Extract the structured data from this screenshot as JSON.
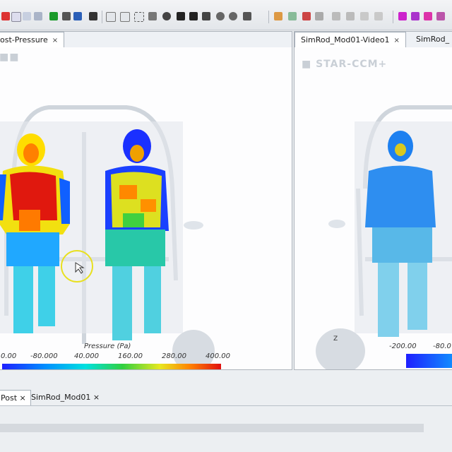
{
  "left_panel": {
    "tab_label": "ost-Pressure",
    "tab_close": "×",
    "legend": {
      "title": "Pressure (Pa)",
      "ticks": [
        "0.00",
        "-80.000",
        "40.000",
        "160.00",
        "280.00",
        "400.00"
      ]
    }
  },
  "right_panel": {
    "tabs": [
      {
        "label": "SimRod_Mod01-Video1",
        "close": "×"
      },
      {
        "label": "SimRod_"
      }
    ],
    "legend": {
      "ticks": [
        "-200.00",
        "-80.0"
      ]
    },
    "triad_label": "Z"
  },
  "bottom_tabs": [
    {
      "label": "Post",
      "close": "×"
    },
    {
      "label": "SimRod_Mod01",
      "close": "×"
    }
  ],
  "colors": {
    "accent_tab_border": "#a7b0ba",
    "colormap": [
      "#1f1fff",
      "#0090ff",
      "#00e0e0",
      "#30d040",
      "#e8e820",
      "#ff8000",
      "#e01010"
    ]
  }
}
